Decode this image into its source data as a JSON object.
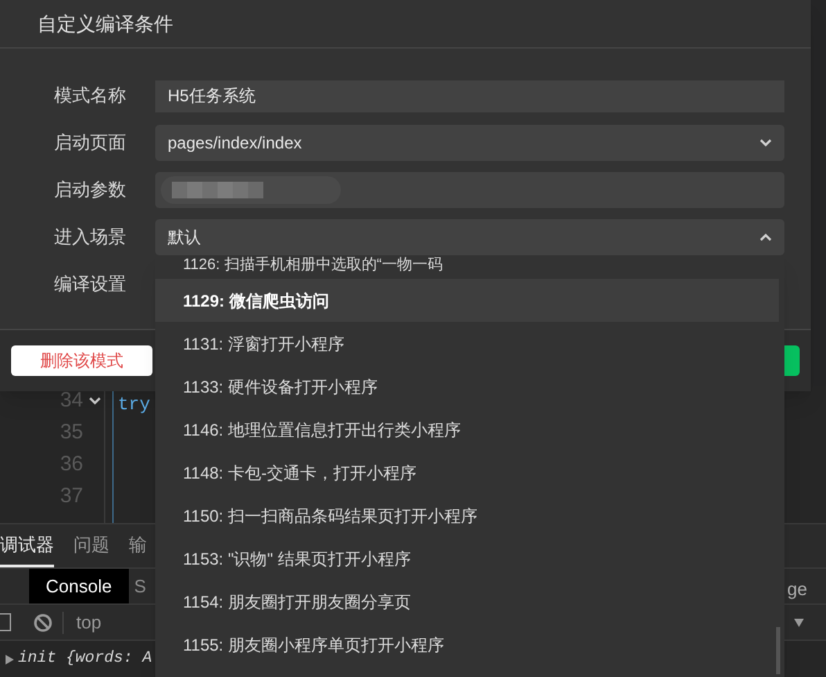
{
  "dialog": {
    "title": "自定义编译条件",
    "fields": [
      {
        "label": "模式名称",
        "kind": "text",
        "value": "H5任务系统"
      },
      {
        "label": "启动页面",
        "kind": "select",
        "value": "pages/index/index",
        "expanded": false
      },
      {
        "label": "启动参数",
        "kind": "blurred"
      },
      {
        "label": "进入场景",
        "kind": "select",
        "value": "默认",
        "expanded": true
      },
      {
        "label": "编译设置",
        "kind": "none"
      }
    ],
    "delete_button": "删除该模式"
  },
  "scene_dropdown": {
    "options": [
      {
        "label": "1126: 扫描手机相册中选取的“一物一码",
        "selected": false
      },
      {
        "label": "1129: 微信爬虫访问",
        "selected": true
      },
      {
        "label": "1131: 浮窗打开小程序",
        "selected": false
      },
      {
        "label": "1133: 硬件设备打开小程序",
        "selected": false
      },
      {
        "label": "1146: 地理位置信息打开出行类小程序",
        "selected": false
      },
      {
        "label": "1148: 卡包-交通卡，打开小程序",
        "selected": false
      },
      {
        "label": "1150: 扫一扫商品条码结果页打开小程序",
        "selected": false
      },
      {
        "label": "1153: \"识物\" 结果页打开小程序",
        "selected": false
      },
      {
        "label": "1154: 朋友圈打开朋友圈分享页",
        "selected": false
      },
      {
        "label": "1155: 朋友圈小程序单页打开小程序",
        "selected": false
      }
    ]
  },
  "background": {
    "editor": {
      "line_numbers": [
        "34",
        "35",
        "36",
        "37"
      ],
      "code": "try"
    },
    "devtools": {
      "tabs": [
        {
          "label": "调试器",
          "selected": true
        },
        {
          "label": "问题",
          "selected": false
        },
        {
          "label": "输",
          "selected": false
        }
      ],
      "panel_tabs": [
        {
          "label": "Console",
          "selected": true
        },
        {
          "label": "S",
          "selected": false
        }
      ],
      "context": "top",
      "log": "init {words: A",
      "side_text": "ge"
    }
  }
}
